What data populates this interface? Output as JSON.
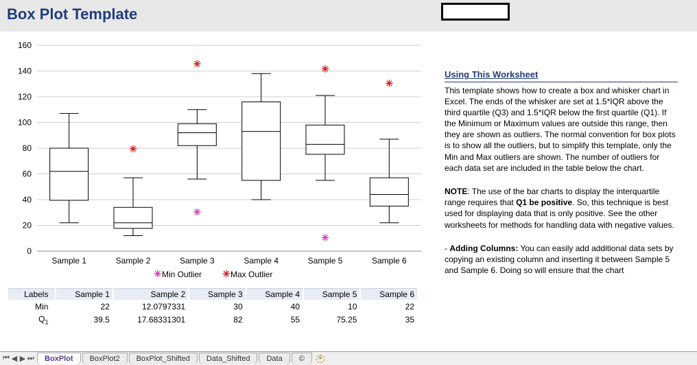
{
  "header": {
    "title": "Box Plot Template"
  },
  "chart_data": {
    "type": "boxplot",
    "ylim": [
      0,
      160
    ],
    "yticks": [
      0,
      20,
      40,
      60,
      80,
      100,
      120,
      140,
      160
    ],
    "categories": [
      "Sample 1",
      "Sample 2",
      "Sample 3",
      "Sample 4",
      "Sample 5",
      "Sample 6"
    ],
    "series": [
      {
        "name": "Sample 1",
        "whisker_low": 22,
        "q1": 39.5,
        "median": 62,
        "q3": 80,
        "whisker_high": 107,
        "outliers_low": [],
        "outliers_high": []
      },
      {
        "name": "Sample 2",
        "whisker_low": 12,
        "q1": 17.68,
        "median": 22,
        "q3": 34,
        "whisker_high": 57,
        "outliers_low": [],
        "outliers_high": [
          79
        ]
      },
      {
        "name": "Sample 3",
        "whisker_low": 56,
        "q1": 82,
        "median": 92,
        "q3": 99,
        "whisker_high": 110,
        "outliers_low": [
          30
        ],
        "outliers_high": [
          145
        ]
      },
      {
        "name": "Sample 4",
        "whisker_low": 40,
        "q1": 55,
        "median": 93,
        "q3": 116,
        "whisker_high": 138,
        "outliers_low": [],
        "outliers_high": []
      },
      {
        "name": "Sample 5",
        "whisker_low": 55,
        "q1": 75.25,
        "median": 83,
        "q3": 98,
        "whisker_high": 121,
        "outliers_low": [
          10
        ],
        "outliers_high": [
          141
        ]
      },
      {
        "name": "Sample 6",
        "whisker_low": 22,
        "q1": 35,
        "median": 44,
        "q3": 57,
        "whisker_high": 87,
        "outliers_low": [],
        "outliers_high": [
          130
        ]
      }
    ],
    "legend": {
      "min_outlier": "Min Outlier",
      "max_outlier": "Max Outlier"
    }
  },
  "table": {
    "header_label": "Labels",
    "rows": [
      {
        "label": "Min",
        "values": [
          "22",
          "12.0797331",
          "30",
          "40",
          "10",
          "22"
        ]
      },
      {
        "label": "Q1",
        "values": [
          "39.5",
          "17.68331301",
          "82",
          "55",
          "75.25",
          "35"
        ]
      }
    ]
  },
  "help": {
    "title": "Using This Worksheet",
    "p1": "This template shows how to create a box and whisker chart in Excel. The ends of the whisker are set at 1.5*IQR above the third quartile (Q3) and 1.5*IQR below the first quartile (Q1). If the Minimum or Maximum values are outside this range, then they are shown as outliers. The normal convention for box plots is to show all the outliers, but to simplify this template, only the Min and Max outliers are shown. The number of outliers for each data set are included in the table below the chart.",
    "p2a": "NOTE",
    "p2b": ": The use of the bar charts to display the interquartile range requires that ",
    "p2c": "Q1 be positive",
    "p2d": ". So, this technique is best used for displaying data that is only positive. See the other worksheets for methods for handling data with negative values.",
    "p3a": "- ",
    "p3b": "Adding Columns:",
    "p3c": " You can easily add additional data sets by copying an existing column and inserting it between Sample 5 and Sample 6. Doing so will ensure that the chart"
  },
  "tabs": {
    "items": [
      "BoxPlot",
      "BoxPlot2",
      "BoxPlot_Shifted",
      "Data_Shifted",
      "Data",
      "©"
    ],
    "active": 0
  }
}
